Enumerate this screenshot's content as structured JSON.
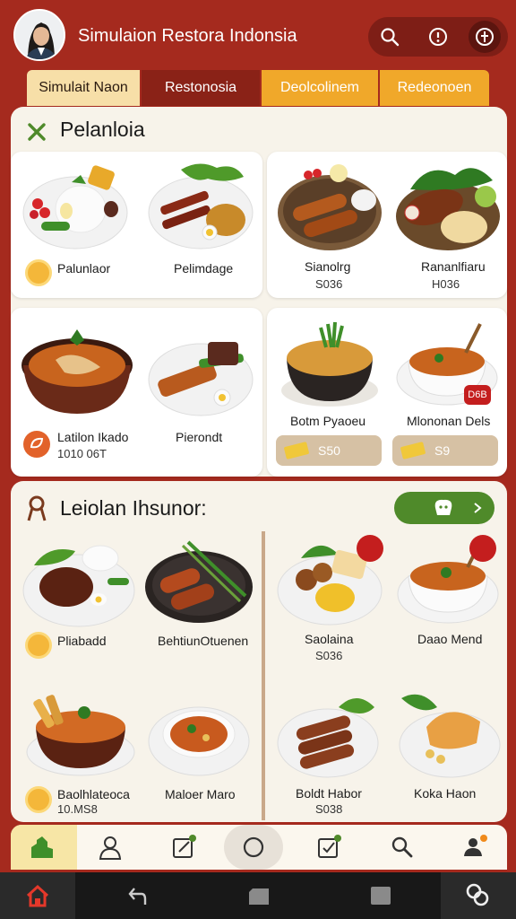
{
  "header": {
    "title": "Simulaion Restora Indonsia",
    "avatar": "avatar",
    "actions": [
      {
        "icon": "search-icon"
      },
      {
        "icon": "alert-icon"
      },
      {
        "icon": "info-icon"
      }
    ]
  },
  "tabs": [
    {
      "label": "Simulait Naon",
      "active": true
    },
    {
      "label": "Restonosia"
    },
    {
      "label": "Deolcolinem"
    },
    {
      "label": "Redeonoen"
    }
  ],
  "section1": {
    "title": "Pelanloia",
    "icon": "close-icon",
    "dishes": [
      {
        "name": "Palunlaor",
        "price": ""
      },
      {
        "name": "Pelimdage",
        "price": ""
      },
      {
        "name": "Sianolrg",
        "price": "S036"
      },
      {
        "name": "Rananlfiaru",
        "price": "H036"
      },
      {
        "name": "Latilon Ikado",
        "price": "1010 06T"
      },
      {
        "name": "Pierondt",
        "price": ""
      },
      {
        "name": "Botm Pyaoeu",
        "price": "",
        "chip": "S50"
      },
      {
        "name": "Mlononan Dels",
        "price": "",
        "chip": "S9",
        "badge": "D6B"
      }
    ]
  },
  "section2": {
    "title": "Leiolan Ihsunor:",
    "icon": "pretzel-icon",
    "action_icon": "chef-hat-icon",
    "dishes": [
      {
        "name": "Pliabadd",
        "price": ""
      },
      {
        "name": "BehtiunOtuenen",
        "price": ""
      },
      {
        "name": "Saolaina",
        "price": "S036"
      },
      {
        "name": "Daao Mend",
        "price": ""
      },
      {
        "name": "Baolhlateoca",
        "price": "10.MS8"
      },
      {
        "name": "Maloer Maro",
        "price": ""
      },
      {
        "name": "Boldt Habor",
        "price": "S038"
      },
      {
        "name": "Koka Haon",
        "price": ""
      }
    ]
  },
  "bottom_nav": [
    {
      "icon": "plant-icon",
      "active": true
    },
    {
      "icon": "profile-icon"
    },
    {
      "icon": "edit-icon",
      "dot": true
    },
    {
      "icon": "circle-icon"
    },
    {
      "icon": "checklist-icon",
      "dot": true
    },
    {
      "icon": "search-icon"
    },
    {
      "icon": "user-settings-icon",
      "badge": true
    }
  ],
  "system_nav": [
    {
      "icon": "home-icon"
    },
    {
      "icon": "back-icon"
    },
    {
      "icon": "recents-icon"
    },
    {
      "icon": "square-icon"
    },
    {
      "icon": "assistant-icon"
    }
  ],
  "colors": {
    "primary": "#a52a1e",
    "dark": "#7e1e16",
    "accent": "#f0a82a",
    "green": "#4f8a2a",
    "panel": "#f7f3ea"
  }
}
